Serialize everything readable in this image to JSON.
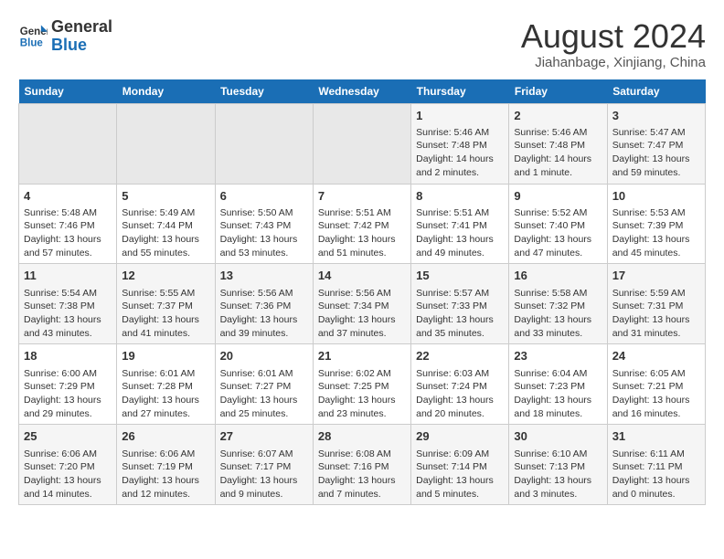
{
  "header": {
    "logo_line1": "General",
    "logo_line2": "Blue",
    "month_title": "August 2024",
    "location": "Jiahanbage, Xinjiang, China"
  },
  "days_of_week": [
    "Sunday",
    "Monday",
    "Tuesday",
    "Wednesday",
    "Thursday",
    "Friday",
    "Saturday"
  ],
  "weeks": [
    [
      {
        "day": "",
        "content": ""
      },
      {
        "day": "",
        "content": ""
      },
      {
        "day": "",
        "content": ""
      },
      {
        "day": "",
        "content": ""
      },
      {
        "day": "1",
        "content": "Sunrise: 5:46 AM\nSunset: 7:48 PM\nDaylight: 14 hours\nand 2 minutes."
      },
      {
        "day": "2",
        "content": "Sunrise: 5:46 AM\nSunset: 7:48 PM\nDaylight: 14 hours\nand 1 minute."
      },
      {
        "day": "3",
        "content": "Sunrise: 5:47 AM\nSunset: 7:47 PM\nDaylight: 13 hours\nand 59 minutes."
      }
    ],
    [
      {
        "day": "4",
        "content": "Sunrise: 5:48 AM\nSunset: 7:46 PM\nDaylight: 13 hours\nand 57 minutes."
      },
      {
        "day": "5",
        "content": "Sunrise: 5:49 AM\nSunset: 7:44 PM\nDaylight: 13 hours\nand 55 minutes."
      },
      {
        "day": "6",
        "content": "Sunrise: 5:50 AM\nSunset: 7:43 PM\nDaylight: 13 hours\nand 53 minutes."
      },
      {
        "day": "7",
        "content": "Sunrise: 5:51 AM\nSunset: 7:42 PM\nDaylight: 13 hours\nand 51 minutes."
      },
      {
        "day": "8",
        "content": "Sunrise: 5:51 AM\nSunset: 7:41 PM\nDaylight: 13 hours\nand 49 minutes."
      },
      {
        "day": "9",
        "content": "Sunrise: 5:52 AM\nSunset: 7:40 PM\nDaylight: 13 hours\nand 47 minutes."
      },
      {
        "day": "10",
        "content": "Sunrise: 5:53 AM\nSunset: 7:39 PM\nDaylight: 13 hours\nand 45 minutes."
      }
    ],
    [
      {
        "day": "11",
        "content": "Sunrise: 5:54 AM\nSunset: 7:38 PM\nDaylight: 13 hours\nand 43 minutes."
      },
      {
        "day": "12",
        "content": "Sunrise: 5:55 AM\nSunset: 7:37 PM\nDaylight: 13 hours\nand 41 minutes."
      },
      {
        "day": "13",
        "content": "Sunrise: 5:56 AM\nSunset: 7:36 PM\nDaylight: 13 hours\nand 39 minutes."
      },
      {
        "day": "14",
        "content": "Sunrise: 5:56 AM\nSunset: 7:34 PM\nDaylight: 13 hours\nand 37 minutes."
      },
      {
        "day": "15",
        "content": "Sunrise: 5:57 AM\nSunset: 7:33 PM\nDaylight: 13 hours\nand 35 minutes."
      },
      {
        "day": "16",
        "content": "Sunrise: 5:58 AM\nSunset: 7:32 PM\nDaylight: 13 hours\nand 33 minutes."
      },
      {
        "day": "17",
        "content": "Sunrise: 5:59 AM\nSunset: 7:31 PM\nDaylight: 13 hours\nand 31 minutes."
      }
    ],
    [
      {
        "day": "18",
        "content": "Sunrise: 6:00 AM\nSunset: 7:29 PM\nDaylight: 13 hours\nand 29 minutes."
      },
      {
        "day": "19",
        "content": "Sunrise: 6:01 AM\nSunset: 7:28 PM\nDaylight: 13 hours\nand 27 minutes."
      },
      {
        "day": "20",
        "content": "Sunrise: 6:01 AM\nSunset: 7:27 PM\nDaylight: 13 hours\nand 25 minutes."
      },
      {
        "day": "21",
        "content": "Sunrise: 6:02 AM\nSunset: 7:25 PM\nDaylight: 13 hours\nand 23 minutes."
      },
      {
        "day": "22",
        "content": "Sunrise: 6:03 AM\nSunset: 7:24 PM\nDaylight: 13 hours\nand 20 minutes."
      },
      {
        "day": "23",
        "content": "Sunrise: 6:04 AM\nSunset: 7:23 PM\nDaylight: 13 hours\nand 18 minutes."
      },
      {
        "day": "24",
        "content": "Sunrise: 6:05 AM\nSunset: 7:21 PM\nDaylight: 13 hours\nand 16 minutes."
      }
    ],
    [
      {
        "day": "25",
        "content": "Sunrise: 6:06 AM\nSunset: 7:20 PM\nDaylight: 13 hours\nand 14 minutes."
      },
      {
        "day": "26",
        "content": "Sunrise: 6:06 AM\nSunset: 7:19 PM\nDaylight: 13 hours\nand 12 minutes."
      },
      {
        "day": "27",
        "content": "Sunrise: 6:07 AM\nSunset: 7:17 PM\nDaylight: 13 hours\nand 9 minutes."
      },
      {
        "day": "28",
        "content": "Sunrise: 6:08 AM\nSunset: 7:16 PM\nDaylight: 13 hours\nand 7 minutes."
      },
      {
        "day": "29",
        "content": "Sunrise: 6:09 AM\nSunset: 7:14 PM\nDaylight: 13 hours\nand 5 minutes."
      },
      {
        "day": "30",
        "content": "Sunrise: 6:10 AM\nSunset: 7:13 PM\nDaylight: 13 hours\nand 3 minutes."
      },
      {
        "day": "31",
        "content": "Sunrise: 6:11 AM\nSunset: 7:11 PM\nDaylight: 13 hours\nand 0 minutes."
      }
    ]
  ]
}
